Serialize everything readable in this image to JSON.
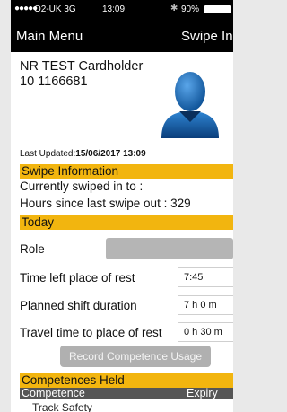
{
  "status_bar": {
    "signal": "●●●●●",
    "carrier": "O2-UK  3G",
    "time": "13:09",
    "battery_level": "90%"
  },
  "nav": {
    "left": "Main Menu",
    "right": "Swipe In"
  },
  "cardholder": {
    "name": "NR TEST Cardholder 10 1166681",
    "last_updated_label": "Last Updated:",
    "last_updated_value": "15/06/2017 13:09"
  },
  "swipe_info": {
    "header": "Swipe Information",
    "currently_swiped": "Currently swiped in to :",
    "hours_since": "Hours since last swipe out : 329"
  },
  "today": {
    "header": "Today",
    "role_label": "Role",
    "time_left_label": "Time left place of rest",
    "time_left_value": "7:45",
    "shift_label": "Planned shift duration",
    "shift_value": "7 h  0 m",
    "travel_label": "Travel time to place of rest",
    "travel_value": "0 h 30 m",
    "record_button": "Record Competence Usage"
  },
  "competences": {
    "header": "Competences Held",
    "col_competence": "Competence",
    "col_expiry": "Expiry",
    "rows": [
      "Track Safety"
    ]
  },
  "colors": {
    "section_accent": "#f2b50f",
    "nav_background": "#000000",
    "table_header": "#555555"
  }
}
